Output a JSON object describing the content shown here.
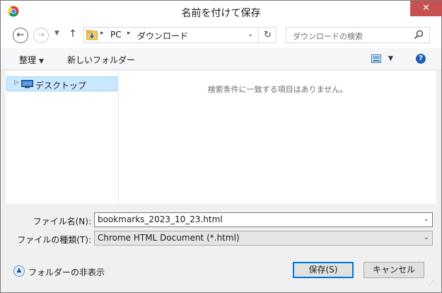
{
  "window": {
    "title": "名前を付けて保存",
    "close_glyph": "✕"
  },
  "nav": {
    "back_glyph": "←",
    "forward_glyph": "→",
    "recent_glyph": "▼",
    "up_glyph": "↑"
  },
  "address": {
    "breadcrumbs": [
      "PC",
      "ダウンロード"
    ],
    "separator_glyph": "▸",
    "dropdown_glyph": "⌄",
    "refresh_glyph": "↻"
  },
  "search": {
    "placeholder": "ダウンロードの検索"
  },
  "toolbar": {
    "organize_label": "整理",
    "organize_caret": "▼",
    "new_folder_label": "新しいフォルダー",
    "view_caret": "▼",
    "help_glyph": "?"
  },
  "nav_pane": {
    "items": [
      {
        "label": "デスクトップ",
        "expand_glyph": "▷",
        "icon": "desktop-icon"
      }
    ]
  },
  "file_pane": {
    "empty_message": "検索条件に一致する項目はありません。"
  },
  "form": {
    "filename_label": "ファイル名(N):",
    "filename_value": "bookmarks_2023_10_23.html",
    "filetype_label": "ファイルの種類(T):",
    "filetype_value": "Chrome HTML Document (*.html)",
    "dropdown_glyph": "⌄"
  },
  "footer": {
    "hide_folders_label": "フォルダーの非表示",
    "hide_folders_glyph": "▲",
    "save_label": "保存(S)",
    "cancel_label": "キャンセル",
    "grip_glyph": "⋰"
  },
  "colors": {
    "accent": "#0078d7",
    "selection": "#cce8ff",
    "close": "#c75050"
  }
}
